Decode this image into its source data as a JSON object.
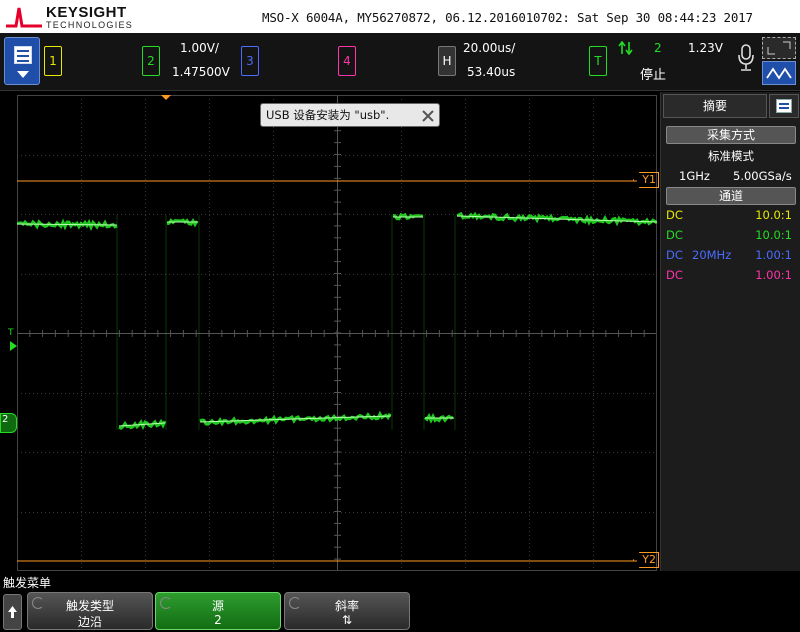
{
  "header": {
    "brand": "KEYSIGHT",
    "brand_sub": "TECHNOLOGIES",
    "instrument_line": "MSO-X 6004A, MY56270872, 06.12.2016010702: Sat Sep 30 08:44:23 2017"
  },
  "channels": [
    {
      "number": "1",
      "color": "#e8e800"
    },
    {
      "number": "2",
      "color": "#22dd22",
      "scale": "1.00V/",
      "offset": "1.47500V"
    },
    {
      "number": "3",
      "color": "#4a6cff"
    },
    {
      "number": "4",
      "color": "#ff33aa"
    }
  ],
  "horizontal": {
    "key": "H",
    "timebase": "20.00us/",
    "delay": "53.40us"
  },
  "trigger": {
    "key": "T",
    "source": "2",
    "level": "1.23V",
    "status": "停止",
    "color": "#22dd22"
  },
  "toast": {
    "message": "USB 设备安装为 \"usb\"."
  },
  "markers": {
    "y1": "Y1",
    "y2": "Y2",
    "trigger_level": "T",
    "ch2_ground": "2"
  },
  "right_panel": {
    "tab_label": "摘要",
    "acquisition_title": "采集方式",
    "acquisition_mode": "标准模式",
    "bandwidth": "1GHz",
    "sample_rate": "5.00GSa/s",
    "channels_title": "通道",
    "channel_rows": [
      {
        "coupling": "DC",
        "extra": "",
        "probe": "10.0:1",
        "color": "#e8e800"
      },
      {
        "coupling": "DC",
        "extra": "",
        "probe": "10.0:1",
        "color": "#22dd22"
      },
      {
        "coupling": "DC",
        "extra": "20MHz",
        "probe": "1.00:1",
        "color": "#4a6cff"
      },
      {
        "coupling": "DC",
        "extra": "",
        "probe": "1.00:1",
        "color": "#ff33aa"
      }
    ]
  },
  "softkeys": {
    "menu_title": "触发菜单",
    "keys": [
      {
        "label": "触发类型",
        "value": "边沿"
      },
      {
        "label": "源",
        "value": "2"
      },
      {
        "label": "斜率",
        "value": "⇅"
      }
    ]
  },
  "colors": {
    "cursor_orange": "#ff9922",
    "trace_green": "#22dd22",
    "grid": "#3a3a3a"
  }
}
